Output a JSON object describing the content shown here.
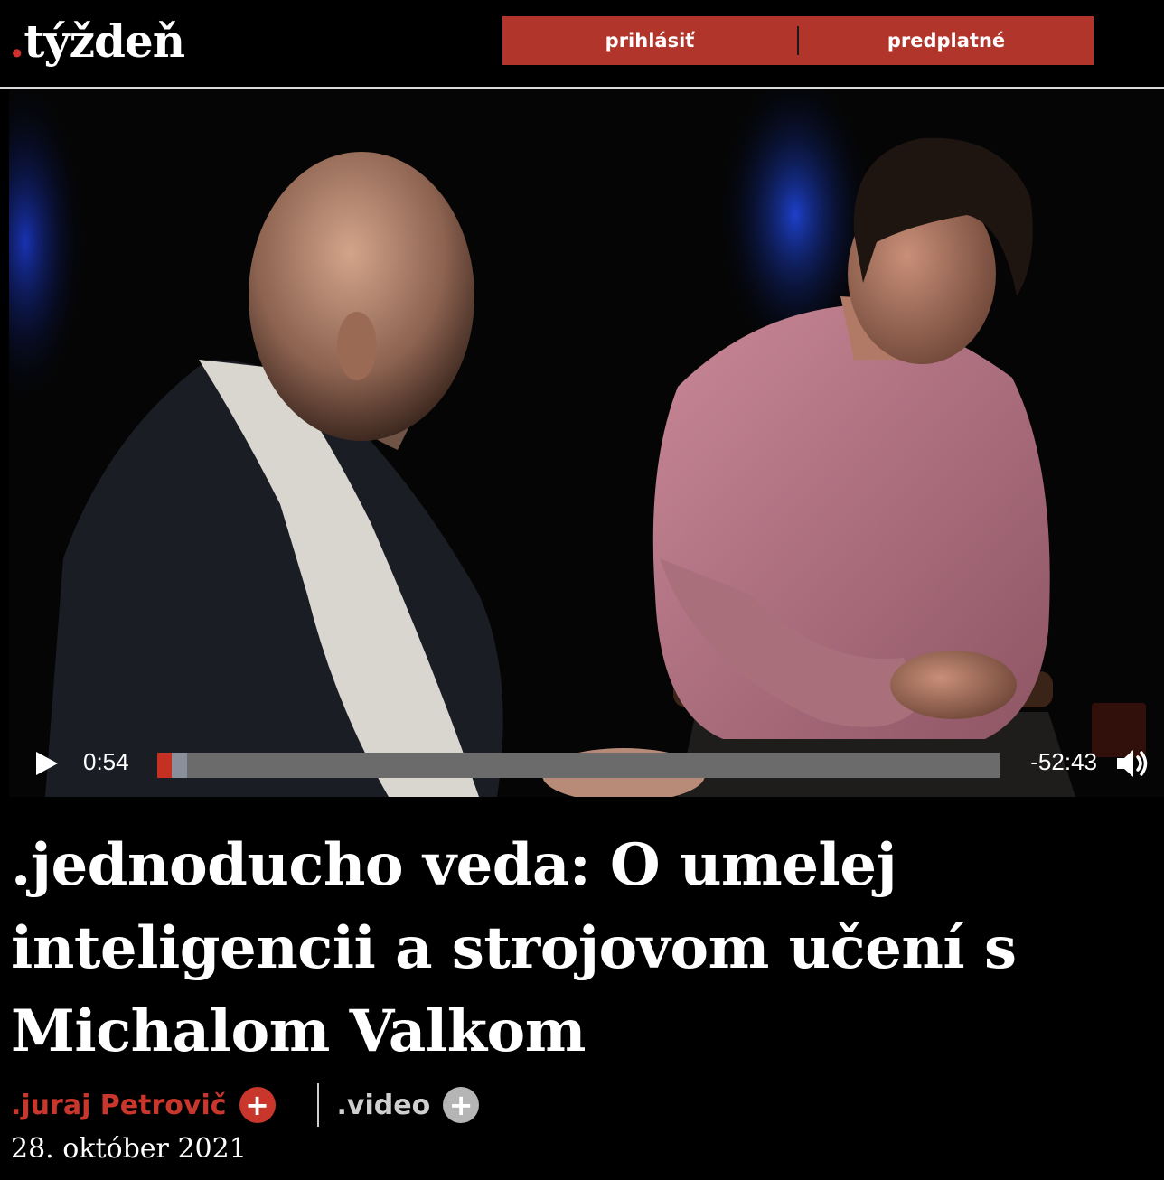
{
  "header": {
    "logo_dot": ".",
    "logo_text": "týždeň",
    "login_label": "prihlásiť",
    "subscribe_label": "predplatné"
  },
  "video": {
    "current_time": "0:54",
    "remaining_time": "-52:43",
    "played_fraction": 0.017,
    "buffered_fraction": 0.035
  },
  "article": {
    "title": ".jednoducho veda: O umelej inteligencii a strojovom učení s Michalom Valkom",
    "author": ".juraj Petrovič",
    "section": ".video",
    "date": "28. október 2021"
  },
  "colors": {
    "brand_red": "#b2352b",
    "author_red": "#c9362c",
    "background": "#000000"
  },
  "icons": {
    "play": "play-icon",
    "volume": "volume-icon",
    "follow": "plus-circle-icon"
  }
}
